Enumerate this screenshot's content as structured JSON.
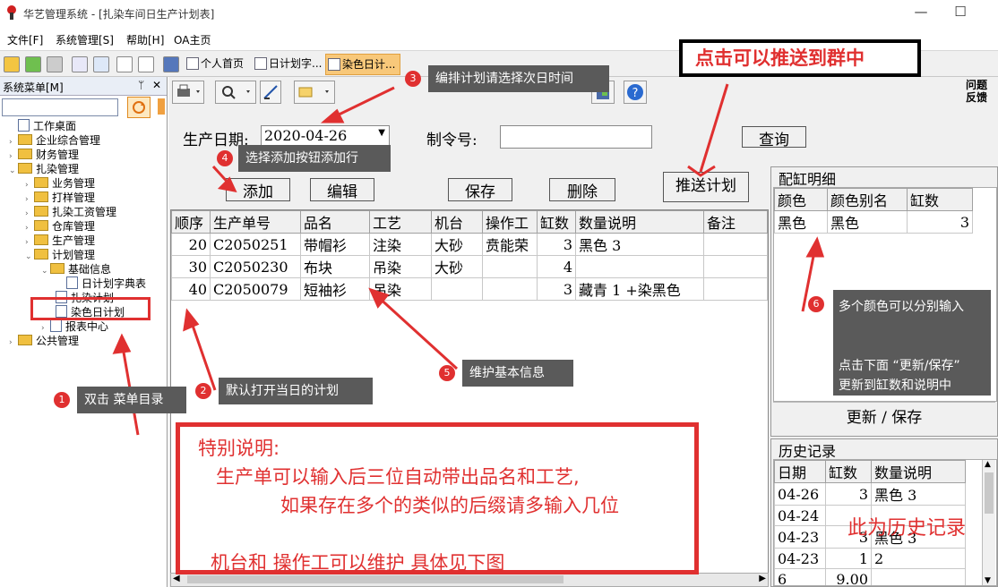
{
  "window": {
    "title": "华艺管理系统 - [扎染车间日生产计划表]",
    "minimize": "—",
    "maximize": "☐"
  },
  "menu": [
    "文件[F]",
    "系统管理[S]",
    "帮助[H]",
    "OA主页"
  ],
  "doc_tabs": [
    "个人首页",
    "日计划字...",
    "染色日计..."
  ],
  "left_panel": {
    "title": "系统菜单[M]",
    "pin": "ᛘ",
    "close": "✕",
    "tree": [
      {
        "label": "工作桌面",
        "type": "page",
        "level": 0
      },
      {
        "label": "企业综合管理",
        "type": "folder",
        "level": 0
      },
      {
        "label": "财务管理",
        "type": "folder",
        "level": 0
      },
      {
        "label": "扎染管理",
        "type": "folder",
        "level": 0
      },
      {
        "label": "业务管理",
        "type": "folder",
        "level": 1
      },
      {
        "label": "打样管理",
        "type": "folder",
        "level": 1
      },
      {
        "label": "扎染工资管理",
        "type": "folder",
        "level": 1
      },
      {
        "label": "仓库管理",
        "type": "folder",
        "level": 1
      },
      {
        "label": "生产管理",
        "type": "folder",
        "level": 1
      },
      {
        "label": "计划管理",
        "type": "folder",
        "level": 1
      },
      {
        "label": "基础信息",
        "type": "folder",
        "level": 2
      },
      {
        "label": "日计划字典表",
        "type": "page",
        "level": 3
      },
      {
        "label": "扎染计划",
        "type": "page",
        "level": 2
      },
      {
        "label": "染色日计划",
        "type": "page",
        "level": 2
      },
      {
        "label": "报表中心",
        "type": "page",
        "level": 1
      },
      {
        "label": "公共管理",
        "type": "folder",
        "level": 0
      }
    ]
  },
  "form": {
    "date_label": "生产日期:",
    "date_value": "2020-04-26",
    "order_label": "制令号:",
    "order_value": "",
    "query": "查询",
    "add": "添加",
    "edit": "编辑",
    "save": "保存",
    "delete": "删除",
    "push": "推送计划",
    "question": "问题反馈"
  },
  "main_table": {
    "headers": [
      "顺序",
      "生产单号",
      "品名",
      "工艺",
      "机台",
      "操作工",
      "缸数",
      "数量说明",
      "备注"
    ],
    "rows": [
      [
        "20",
        "C2050251",
        "带帽衫",
        "注染",
        "大砂",
        "贲能荣",
        "3",
        "黑色 3",
        ""
      ],
      [
        "30",
        "C2050230",
        "布块",
        "吊染",
        "大砂",
        "",
        "4",
        "",
        ""
      ],
      [
        "40",
        "C2050079",
        "短袖衫",
        "吊染",
        "",
        "",
        "3",
        "藏青 1 +染黑色",
        ""
      ]
    ]
  },
  "vat_detail": {
    "title": "配缸明细",
    "headers": [
      "颜色",
      "颜色别名",
      "缸数"
    ],
    "rows": [
      [
        "黑色",
        "黑色",
        "3"
      ]
    ],
    "update_button": "更新 / 保存"
  },
  "history": {
    "title": "历史记录",
    "headers": [
      "日期",
      "缸数",
      "数量说明"
    ],
    "rows": [
      [
        "04-26",
        "3",
        "黑色 3"
      ],
      [
        "04-24",
        "",
        ""
      ],
      [
        "04-23",
        "3",
        "黑色 3"
      ],
      [
        "04-23",
        "1",
        "2"
      ]
    ],
    "footer": [
      "6",
      "9.00"
    ]
  },
  "annotations": {
    "c1": "双击 菜单目录",
    "c2": "默认打开当日的计划",
    "c3": "编排计划请选择次日时间",
    "c4": "选择添加按钮添加行",
    "c5": "维护基本信息",
    "c6a": "多个颜色可以分别输入",
    "c6b": "点击下面 “更新/保存”",
    "c6c": "更新到缸数和说明中",
    "push_note": "点击可以推送到群中",
    "history_note": "此为历史记录",
    "special_title": "特别说明:",
    "special_1": "生产单可以输入后三位自动带出品名和工艺,",
    "special_2": "如果存在多个的类似的后缀请多输入几位",
    "special_3": "机台和  操作工可以维护 具体见下图",
    "n1": "1",
    "n2": "2",
    "n3": "3",
    "n4": "4",
    "n5": "5",
    "n6": "6"
  },
  "colors": {
    "annotation_red": "#e03030",
    "callout_bg": "#5a5a5a"
  }
}
